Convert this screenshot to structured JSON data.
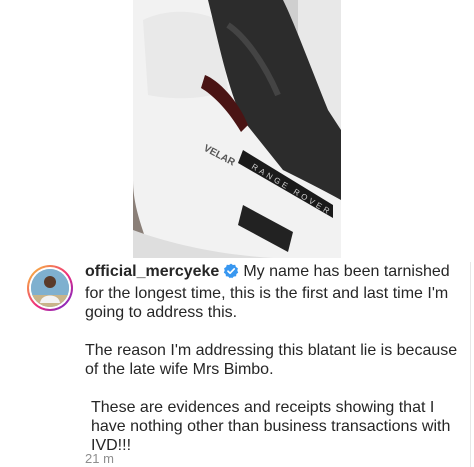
{
  "post": {
    "photo_description_icon": "car-photo",
    "car_badge": "VELAR",
    "car_brand_lettering": "RANGE ROVER"
  },
  "comment": {
    "username": "official_mercyeke",
    "verified_icon": "verified-badge-icon",
    "paragraph_1": "My name has been tarnished for the longest time, this is the first and last time I'm going to address this.",
    "paragraph_2": "The reason I'm addressing this blatant lie is because of the late wife Mrs Bimbo.",
    "paragraph_3": "These are evidences and receipts showing that I have nothing other than business transactions with IVD!!!",
    "timestamp": "21 m"
  },
  "colors": {
    "verified_blue": "#3897f0",
    "text": "#262626",
    "muted": "#8e8e8e"
  }
}
